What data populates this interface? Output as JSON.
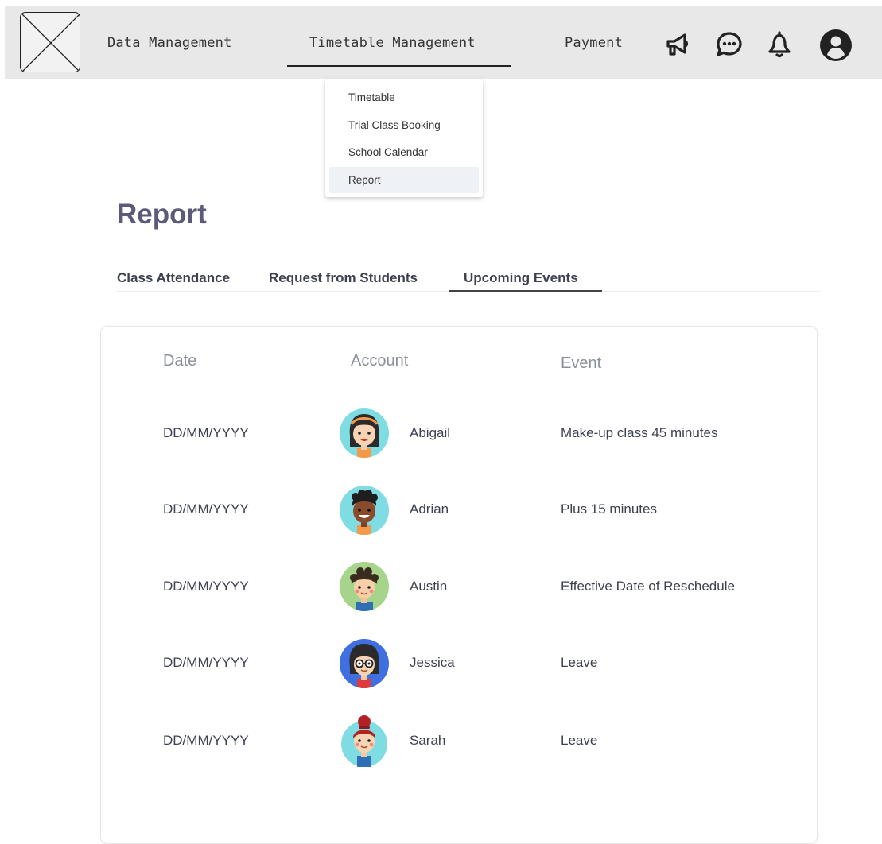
{
  "nav": {
    "items": [
      "Data Management",
      "Timetable Management",
      "Payment"
    ],
    "active_index": 1,
    "icons": [
      "megaphone-icon",
      "chat-icon",
      "bell-icon",
      "user-icon"
    ]
  },
  "dropdown": {
    "items": [
      "Timetable",
      "Trial Class Booking",
      "School Calendar",
      "Report"
    ],
    "selected": "Report"
  },
  "page": {
    "title": "Report"
  },
  "tabs": {
    "items": [
      "Class Attendance",
      "Request from Students",
      "Upcoming Events"
    ],
    "active": "Upcoming Events"
  },
  "table": {
    "headers": {
      "date": "Date",
      "account": "Account",
      "event": "Event"
    },
    "rows": [
      {
        "date": "DD/MM/YYYY",
        "account": "Abigail",
        "event": "Make-up class 45 minutes"
      },
      {
        "date": "DD/MM/YYYY",
        "account": "Adrian",
        "event": "Plus 15 minutes"
      },
      {
        "date": "DD/MM/YYYY",
        "account": "Austin",
        "event": "Effective Date of Reschedule"
      },
      {
        "date": "DD/MM/YYYY",
        "account": "Jessica",
        "event": "Leave"
      },
      {
        "date": "DD/MM/YYYY",
        "account": "Sarah",
        "event": "Leave"
      }
    ]
  },
  "colors": {
    "title": "#5b5a7a",
    "topbar": "#e8e8e8",
    "avatar_backgrounds": [
      "#7fdce3",
      "#7fdce3",
      "#a6d48a",
      "#3f6fe0",
      "#7fdce3"
    ]
  }
}
